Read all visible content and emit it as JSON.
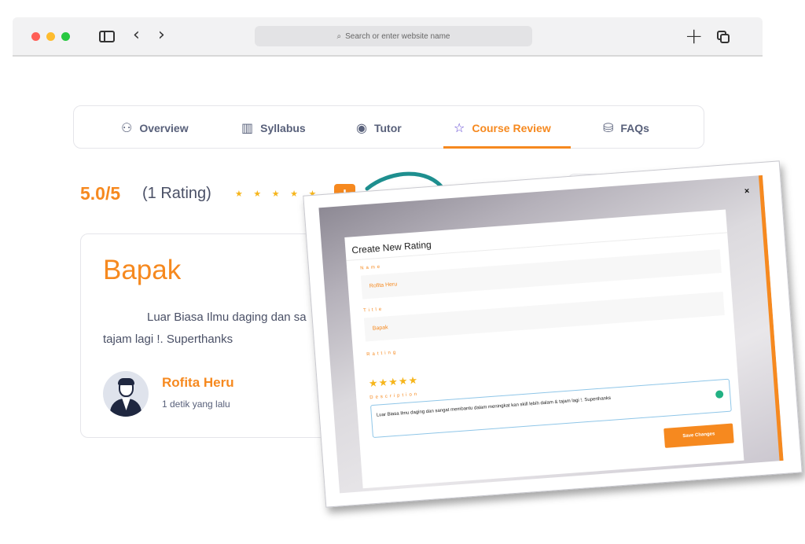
{
  "browser": {
    "address_placeholder": "Search or enter website name",
    "icons": [
      "sidebar-toggle-icon",
      "back-arrow-icon",
      "forward-arrow-icon",
      "search-icon",
      "new-tab-icon",
      "tabs-overview-icon"
    ]
  },
  "course_tabs": {
    "items": [
      {
        "label": "Overview",
        "icon": "grid-circles-icon",
        "active": false
      },
      {
        "label": "Syllabus",
        "icon": "map-icon",
        "active": false
      },
      {
        "label": "Tutor",
        "icon": "user-circle-icon",
        "active": false
      },
      {
        "label": "Course Review",
        "icon": "star-outline-icon",
        "active": true
      },
      {
        "label": "FAQs",
        "icon": "database-icon",
        "active": false
      }
    ],
    "active_color": "#f6891f"
  },
  "rating_summary": {
    "score": "5.0/5",
    "count": "(1 Rating)",
    "stars": 5,
    "stars_glyph": "★★★★★",
    "add_button": "+"
  },
  "review": {
    "title": "Bapak",
    "body": "Luar Biasa Ilmu daging dan sa... tajam lagi !. Superthanks",
    "body_line1": "Luar Biasa Ilmu daging dan sa",
    "body_line2": "tajam lagi !. Superthanks",
    "reviewer_name": "Rofita Heru",
    "time_ago": "1 detik yang lalu"
  },
  "modal": {
    "title": "Create New Rating",
    "close_label": "×",
    "fields": {
      "name_label": "Name",
      "name_value": "Rofita Heru",
      "title_label": "Title",
      "title_value": "Bapak",
      "rating_label": "Ratting",
      "rating_stars": "★★★★★",
      "description_label": "Description",
      "description_value": "Luar Biasa Ilmu daging dan sangat membantu dalam meningkat kan skill lebih dalam & tajam lagi !. Superthanks"
    },
    "save_label": "Save Changes"
  },
  "colors": {
    "accent": "#f6891f",
    "star": "#f6b51b",
    "arrow": "#1e8f8f",
    "text": "#4a5066"
  }
}
